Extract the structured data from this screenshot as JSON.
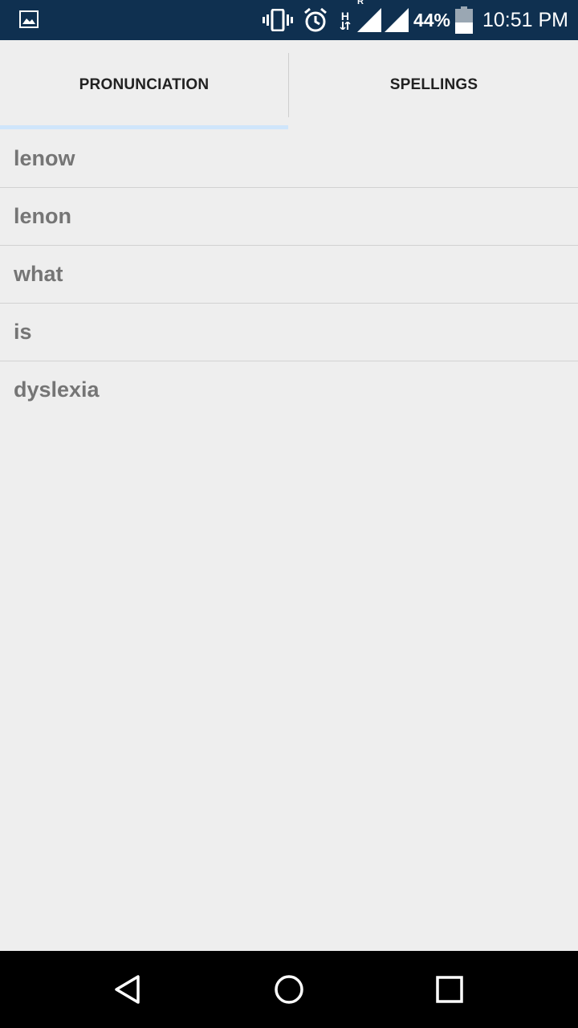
{
  "status_bar": {
    "notification_icon": "image-icon",
    "icons": [
      "vibrate-icon",
      "alarm-icon",
      "network-type-icon",
      "signal-roaming-icon",
      "signal-icon"
    ],
    "network_type": "H",
    "roaming_label": "R",
    "battery_percent": "44%",
    "battery_level": 0.44,
    "time": "10:51 PM",
    "background_color": "#0f3050"
  },
  "tabs": [
    {
      "label": "PRONUNCIATION",
      "selected": true
    },
    {
      "label": "SPELLINGS",
      "selected": false
    }
  ],
  "indicator_color": "#cfe5fb",
  "list": {
    "items": [
      "lenow",
      "lenon",
      "what",
      "is",
      "dyslexia"
    ]
  },
  "nav_bar": {
    "buttons": [
      "back-icon",
      "home-icon",
      "recents-icon"
    ]
  }
}
